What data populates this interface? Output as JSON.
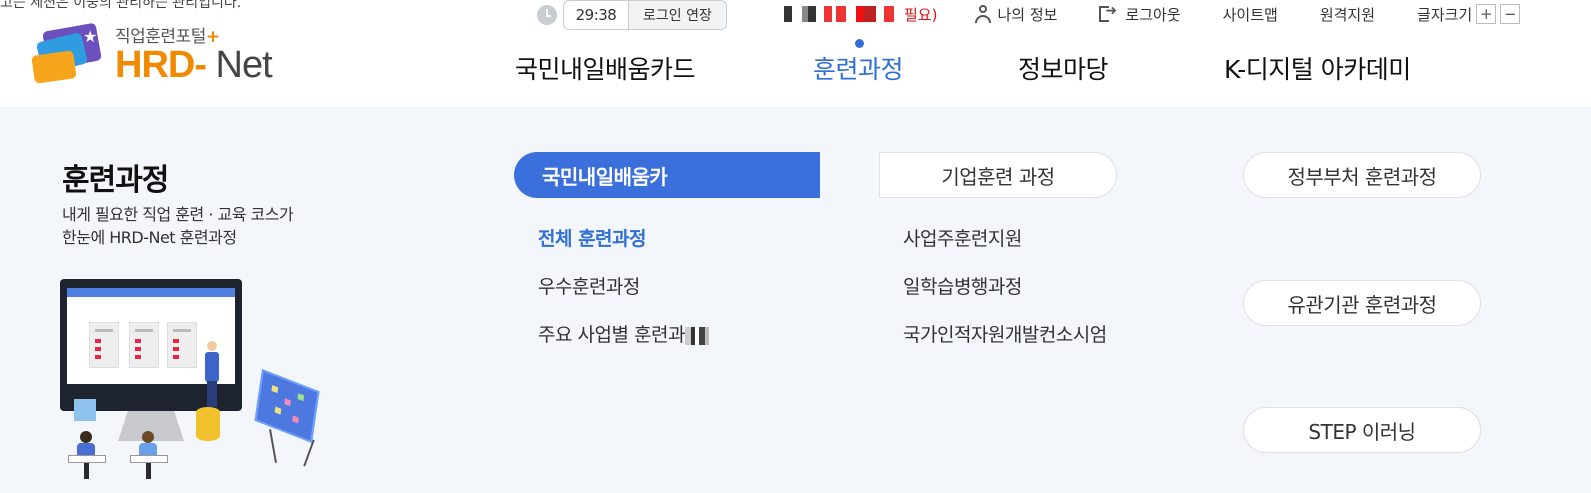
{
  "top_notice": "고는 세션은 이중의 관리하는 관리입니다.",
  "util": {
    "timer": "29:38",
    "extend_label": "로그인 연장",
    "notice_suffix": "필요)",
    "my_info": "나의 정보",
    "logout": "로그아웃",
    "sitemap": "사이트맵",
    "remote_support": "원격지원",
    "font_size": "글자크기",
    "font_plus": "+",
    "font_minus": "−"
  },
  "logo": {
    "subtitle": "직업훈련포털",
    "plus": "+",
    "brand_hrd": "HRD",
    "brand_dash": "-",
    "brand_net": "Net"
  },
  "gnb": [
    {
      "label": "국민내일배움카드",
      "active": false
    },
    {
      "label": "훈련과정",
      "active": true
    },
    {
      "label": "정보마당",
      "active": false
    },
    {
      "label": "K-디지털 아카데미",
      "active": false
    }
  ],
  "panel": {
    "title": "훈련과정",
    "desc_line1": "내게 필요한 직업 훈련 · 교육 코스가",
    "desc_line2": "한눈에 HRD-Net 훈련과정"
  },
  "groups": {
    "card": {
      "label": "국민내일배움카",
      "links": [
        "전체 훈련과정",
        "우수훈련과정",
        "주요 사업별 훈련과"
      ]
    },
    "corp": {
      "label": "기업훈련 과정",
      "links": [
        "사업주훈련지원",
        "일학습병행과정",
        "국가인적자원개발컨소시엄"
      ]
    },
    "gov": {
      "label": "정부부처 훈련과정"
    },
    "related": {
      "label": "유관기관 훈련과정"
    },
    "step": {
      "label": "STEP 이러닝"
    }
  },
  "colors": {
    "accent": "#2f6fd6",
    "primary_button": "#3a6fdc",
    "brand_orange": "#f08a00",
    "panel_bg": "#f3f6fa",
    "notice_red": "#d11111"
  },
  "icons": [
    "clock-icon",
    "user-icon",
    "logout-icon",
    "plus-icon",
    "minus-icon"
  ]
}
